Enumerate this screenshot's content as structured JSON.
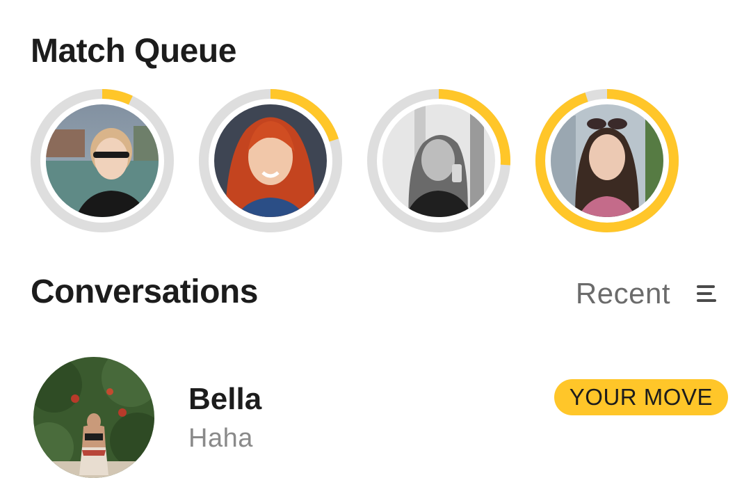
{
  "match_queue": {
    "title": "Match Queue",
    "accent_color": "#ffc629",
    "track_color": "#dedede",
    "items": [
      {
        "progress": 0.07,
        "photo": "woman-sunglasses-waterfront-photo"
      },
      {
        "progress": 0.2,
        "photo": "woman-red-hair-denim-photo"
      },
      {
        "progress": 0.26,
        "photo": "woman-mirror-selfie-bw-photo"
      },
      {
        "progress": 0.95,
        "photo": "woman-dark-hair-floral-photo"
      }
    ]
  },
  "conversations": {
    "title": "Conversations",
    "sort_label": "Recent",
    "sort_icon": "sort-lines-icon",
    "items": [
      {
        "name": "Bella",
        "message": "Haha",
        "badge": "YOUR MOVE",
        "photo": "woman-garden-bikini-photo"
      }
    ]
  }
}
